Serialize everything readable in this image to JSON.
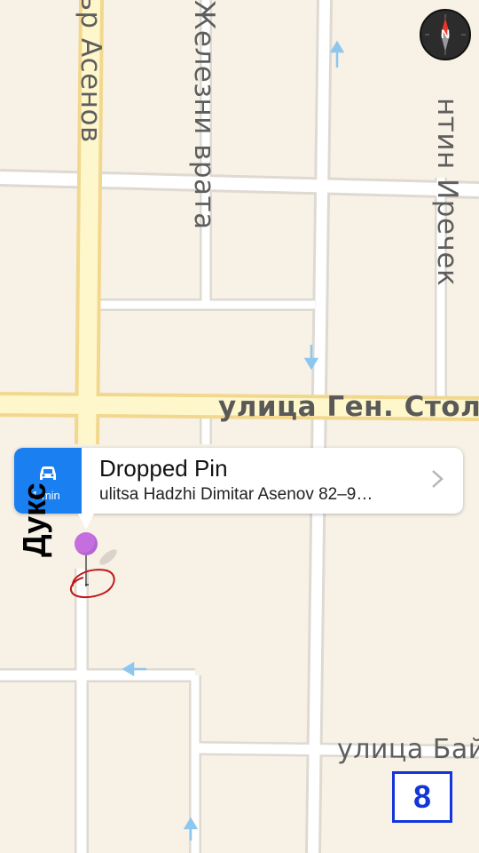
{
  "map": {
    "streets": {
      "asenov": "ър Асенов",
      "zhelezni_vrata": "Железни врата",
      "irechek": "нтин Иречек",
      "stoletov": "улица Ген. Столе",
      "bay": "улица Бай"
    },
    "compass_label": "N",
    "colors": {
      "background": "#f7f1e6",
      "road": "#ffffff",
      "road_edge": "#dedad2",
      "major_road": "#fff7cc",
      "major_road_edge": "#f2d88e",
      "oneway_arrow": "#8dc7f0",
      "pin": "#c46ee0"
    }
  },
  "callout": {
    "title": "Dropped Pin",
    "subtitle": "ulitsa Hadzhi Dimitar Asenov 82–9…",
    "car_icon": "car-icon",
    "car_sub": "1 min",
    "accent": "#1a7ff0"
  },
  "annotation": {
    "handwritten_text": "Дукс",
    "circle_color": "#c01818"
  },
  "page_badge": "8"
}
